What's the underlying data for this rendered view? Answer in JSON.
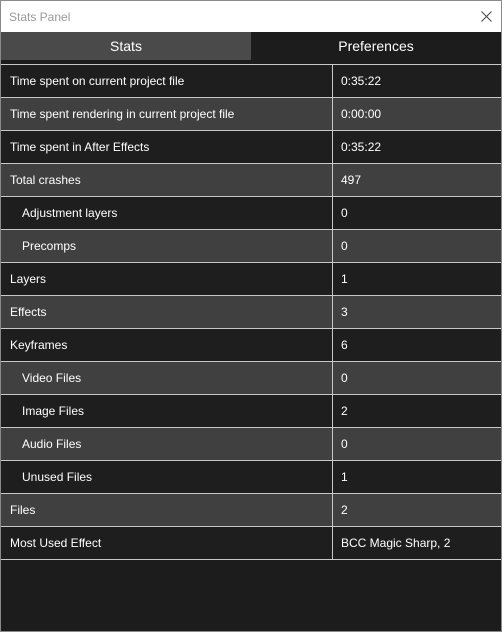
{
  "window": {
    "title": "Stats Panel"
  },
  "tabs": [
    {
      "label": "Stats",
      "active": true
    },
    {
      "label": "Preferences",
      "active": false
    }
  ],
  "stats": [
    {
      "label": "Time spent on current project file",
      "value": "0:35:22",
      "indent": false
    },
    {
      "label": "Time spent rendering in current project file",
      "value": "0:00:00",
      "indent": false
    },
    {
      "label": "Time spent in After Effects",
      "value": "0:35:22",
      "indent": false
    },
    {
      "label": "Total crashes",
      "value": "497",
      "indent": false
    },
    {
      "label": "Adjustment layers",
      "value": "0",
      "indent": true
    },
    {
      "label": "Precomps",
      "value": "0",
      "indent": true
    },
    {
      "label": "Layers",
      "value": "1",
      "indent": false
    },
    {
      "label": "Effects",
      "value": "3",
      "indent": false
    },
    {
      "label": "Keyframes",
      "value": "6",
      "indent": false
    },
    {
      "label": "Video Files",
      "value": "0",
      "indent": true
    },
    {
      "label": "Image Files",
      "value": "2",
      "indent": true
    },
    {
      "label": "Audio Files",
      "value": "0",
      "indent": true
    },
    {
      "label": "Unused Files",
      "value": "1",
      "indent": true
    },
    {
      "label": "Files",
      "value": "2",
      "indent": false
    },
    {
      "label": "Most Used Effect",
      "value": "BCC Magic Sharp, 2",
      "indent": false
    }
  ],
  "colors": {
    "row_dark": "#1e1e1e",
    "row_light": "#404040",
    "tab_active": "#4a4a4a",
    "grid_line": "#c8c8c8"
  }
}
